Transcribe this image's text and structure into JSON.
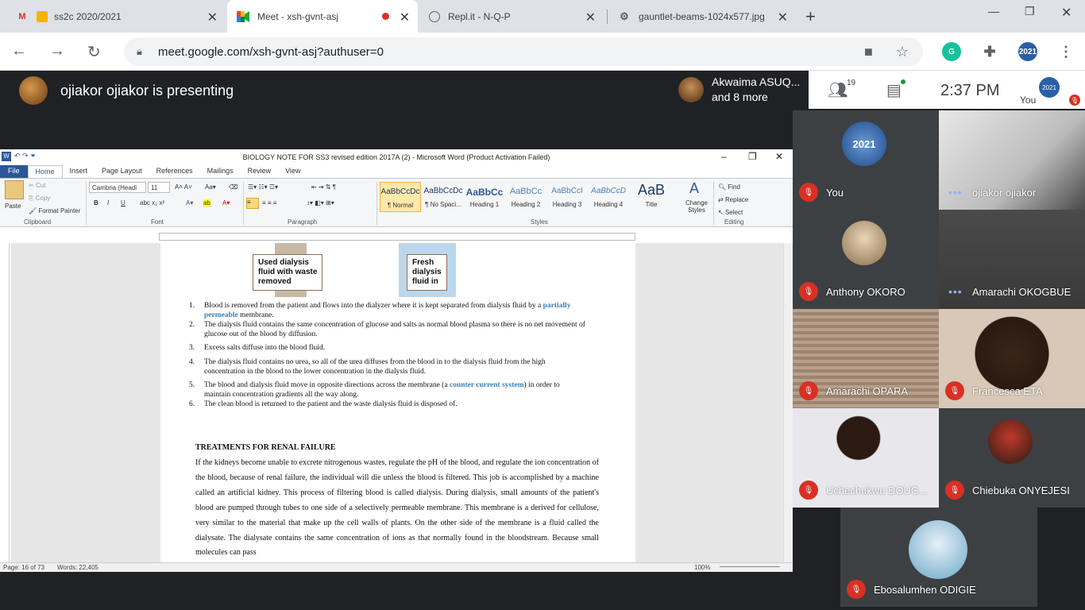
{
  "browser": {
    "tabs": [
      {
        "title": "ss2c 2020/2021",
        "icon": "gmail-icon"
      },
      {
        "title": "Meet - xsh-gvnt-asj",
        "icon": "meet-icon",
        "active": true,
        "recording": true
      },
      {
        "title": "Repl.it - N-Q-P",
        "icon": "replit-icon"
      },
      {
        "title": "gauntlet-beams-1024x577.jpg",
        "icon": "image-icon"
      }
    ],
    "url": "meet.google.com/xsh-gvnt-asj?authuser=0",
    "profile_label": "2021"
  },
  "meet": {
    "presenting_text": "ojiakor ojiakor is presenting",
    "top_participant": {
      "name": "Akwaima ASUQ...",
      "more": "and 8 more"
    },
    "participants_count": "19",
    "clock": "2:37 PM",
    "you_label": "You",
    "you_avatar_text": "2021",
    "tiles": [
      {
        "name": "You",
        "muted": true,
        "avatar": "2021"
      },
      {
        "name": "ojiakor ojiakor",
        "muted": false,
        "video": true
      },
      {
        "name": "Anthony OKORO",
        "muted": true,
        "avatar": "cat"
      },
      {
        "name": "Amarachi OKOGBUE",
        "muted": false,
        "video": true
      },
      {
        "name": "Amarachi OPARA",
        "muted": true,
        "video": true
      },
      {
        "name": "Francesca ETA",
        "muted": true,
        "video": true
      },
      {
        "name": "Uchechukwu DOUG...",
        "muted": true,
        "video": true
      },
      {
        "name": "Chiebuka ONYEJESI",
        "muted": true,
        "avatar": "player"
      },
      {
        "name": "Ebosalumhen ODIGIE",
        "muted": true,
        "avatar": "anime"
      }
    ]
  },
  "word": {
    "title": "BIOLOGY NOTE  FOR SS3 revised edition 2017A (2)  -  Microsoft Word (Product Activation Failed)",
    "tabs": [
      "File",
      "Home",
      "Insert",
      "Page Layout",
      "References",
      "Mailings",
      "Review",
      "View"
    ],
    "clipboard": {
      "paste": "Paste",
      "cut": "Cut",
      "copy": "Copy",
      "format_painter": "Format Painter",
      "group": "Clipboard"
    },
    "font": {
      "name": "Cambria (Headi",
      "size": "11",
      "group": "Font"
    },
    "paragraph_group": "Paragraph",
    "styles": [
      {
        "preview": "AaBbCcDc",
        "name": "¶ Normal"
      },
      {
        "preview": "AaBbCcDc",
        "name": "¶ No Spaci..."
      },
      {
        "preview": "AaBbCc",
        "name": "Heading 1"
      },
      {
        "preview": "AaBbCc",
        "name": "Heading 2"
      },
      {
        "preview": "AaBbCcI",
        "name": "Heading 3"
      },
      {
        "preview": "AaBbCcD",
        "name": "Heading 4"
      },
      {
        "preview": "AaB",
        "name": "Title"
      }
    ],
    "change_styles": "Change Styles",
    "styles_group": "Styles",
    "editing": {
      "find": "Find",
      "replace": "Replace",
      "select": "Select",
      "group": "Editing"
    },
    "diagram": {
      "used": [
        "Used dialysis",
        "fluid with waste",
        "removed"
      ],
      "fresh": [
        "Fresh",
        "dialysis",
        "fluid in"
      ]
    },
    "steps": [
      {
        "n": "1.",
        "pre": "Blood is removed from the patient and flows into the dialyzer where it is kept separated  from dialysis fluid by a ",
        "hl": "partially permeable",
        "post": " membrane."
      },
      {
        "n": "2.",
        "pre": "The dialysis fluid contains the same concentration of glucose and salts as normal blood plasma so there is no net movement of glucose out of the blood by diffusion.",
        "hl": "",
        "post": ""
      },
      {
        "n": "3.",
        "pre": "Excess salts diffuse into the blood fluid.",
        "hl": "",
        "post": ""
      },
      {
        "n": "4.",
        "pre": "The dialysis fluid contains no urea, so all of the urea diffuses from the blood in to the dialysis fluid from the high concentration in the blood to the lower concentration in the dialysis  fluid.",
        "hl": "",
        "post": ""
      },
      {
        "n": "5.",
        "pre": "The blood and dialysis fluid move in opposite directions across the membrane (a ",
        "hl": "counter current system",
        "post": ") in order to maintain concentration gradients all the way along."
      },
      {
        "n": "6.",
        "pre": "The clean blood is returned to the patient and the waste dialysis fluid is disposed of.",
        "hl": "",
        "post": ""
      }
    ],
    "heading": "TREATMENTS FOR RENAL FAILURE",
    "paragraph": "If the kidneys become unable to excrete nitrogenous wastes, regulate the pH of the blood, and regulate the ion concentration of the blood, because of renal failure, the individual will die unless the blood is filtered. This job is accomplished by a machine called an artificial kidney. This process of filtering blood is called dialysis. During dialysis, small amounts of the patient's blood are pumped through tubes to one side of a selectively permeable membrane. This membrane is a derived for cellulose, very similar to the material that make up the cell walls of plants. On the other side of the membrane is a fluid called the dialysate. The dialysate contains the same concentration of ions as that normally found in the bloodstream. Because small molecules can pass",
    "status": {
      "page": "Page: 16 of 73",
      "words": "Words: 22,405",
      "zoom": "100%"
    }
  },
  "colors": {
    "meet_bg": "#202124",
    "mute_red": "#d93025",
    "word_blue": "#2b579a",
    "highlight": "#3a80b9"
  }
}
